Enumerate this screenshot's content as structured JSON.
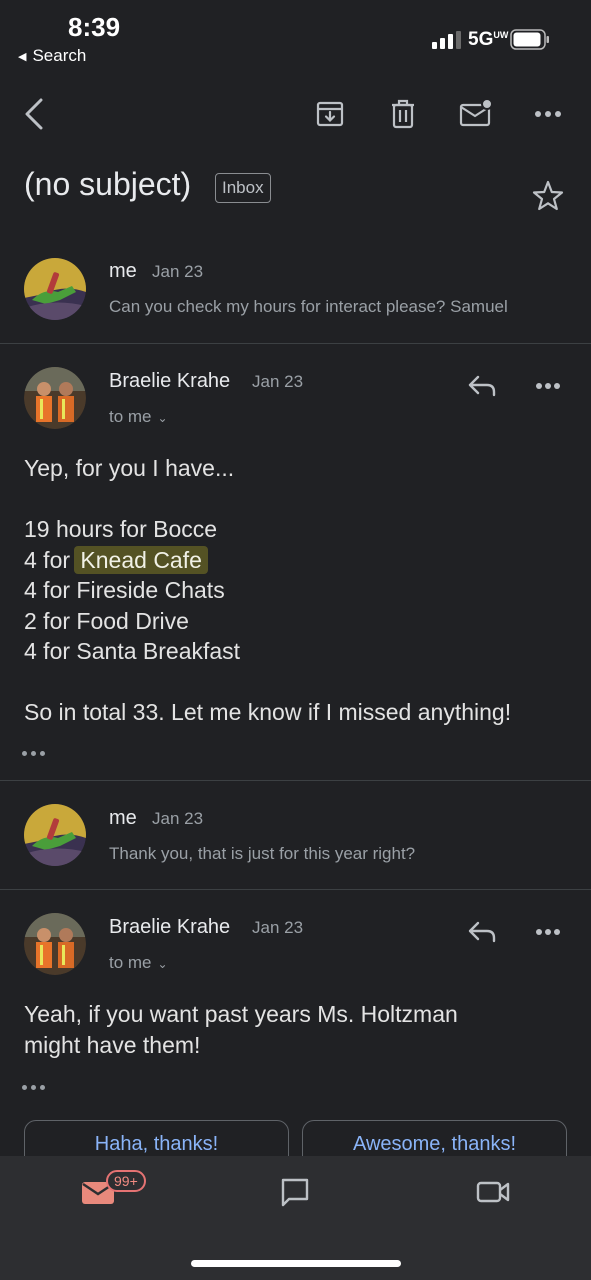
{
  "status_bar": {
    "time": "8:39",
    "back_app": "Search",
    "network": "5G",
    "network_sup": "UW"
  },
  "toolbar": {
    "icons": [
      "back-arrow-icon",
      "archive-icon",
      "trash-icon",
      "mark-unread-icon",
      "more-icon"
    ]
  },
  "thread": {
    "subject": "(no subject)",
    "label": "Inbox",
    "starred": false
  },
  "messages": [
    {
      "sender": "me",
      "date": "Jan 23",
      "snippet": "Can you check my hours for interact please? Samuel",
      "collapsed": true
    },
    {
      "sender": "Braelie Krahe",
      "date": "Jan 23",
      "recipient": "to me",
      "collapsed": false,
      "body": {
        "greeting": "Yep, for you I have...",
        "line1": "19 hours for Bocce",
        "line2_prefix": "4 for",
        "line2_highlight": "Knead Cafe",
        "line3": "4 for Fireside Chats",
        "line4": "2 for Food Drive",
        "line5": "4 for Santa Breakfast",
        "closing": "So in total 33. Let me know if I missed anything!"
      }
    },
    {
      "sender": "me",
      "date": "Jan 23",
      "snippet": "Thank you, that is just for this year right?",
      "collapsed": true
    },
    {
      "sender": "Braelie Krahe",
      "date": "Jan 23",
      "recipient": "to me",
      "collapsed": false,
      "body": {
        "line1": "Yeah, if you want past years Ms. Holtzman",
        "line2": "might have them!"
      }
    }
  ],
  "smart_replies": [
    "Haha, thanks!",
    "Awesome, thanks!"
  ],
  "bottom_nav": {
    "items": [
      "mail-icon",
      "chat-icon",
      "meet-icon"
    ],
    "mail_badge": "99+"
  },
  "colors": {
    "background": "#202124",
    "bottom_nav": "#2d2e31",
    "accent_link": "#8ab4f8",
    "badge": "#f28b82",
    "mail_icon": "#e8897c",
    "highlight": "#545224"
  }
}
